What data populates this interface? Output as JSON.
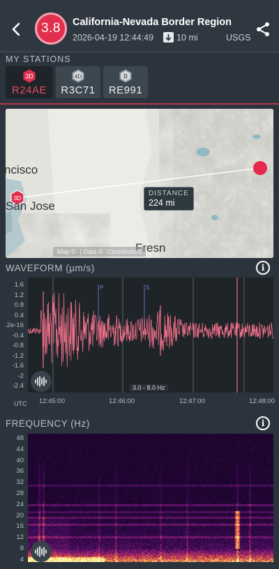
{
  "header": {
    "back_icon": "arrow-left-icon",
    "magnitude": "3.8",
    "title": "California-Nevada Border Region",
    "datetime": "2026-04-19 12:44:49",
    "distance": "10 mi",
    "distance_icon": "arrow-down-icon",
    "source": "USGS",
    "share_icon": "share-icon",
    "accent_color": "#e0304e"
  },
  "stations": {
    "section_label": "MY STATIONS",
    "items": [
      {
        "badge": "3D",
        "name": "R24AE",
        "active": true
      },
      {
        "badge": "4D",
        "name": "R3C71",
        "active": false
      },
      {
        "badge": "B",
        "name": "RE991",
        "active": false
      }
    ]
  },
  "map": {
    "labels": [
      "ncisco",
      "San Jose",
      "Fresn"
    ],
    "distance_label": "DISTANCE",
    "distance_value": "224 mi",
    "station_badge": "3D",
    "attribution_left": "Map ©",
    "attribution_mid": "| Data ©",
    "attribution_right": "Contributors"
  },
  "waveform": {
    "title": "WAVEFORM (µm/s)",
    "info_icon": "info-icon",
    "y_ticks": [
      "1.6",
      "1.2",
      "0.8",
      "0.4",
      ".2e-16",
      "-0.4",
      "-0.8",
      "-1.2",
      "-1.6",
      "-2",
      "-2.4"
    ],
    "x_ticks": [
      "12:45:00",
      "12:46:00",
      "12:47:00",
      "12:48:00"
    ],
    "x_axis_label": "UTC",
    "phase_markers": [
      "P",
      "S"
    ],
    "band": "3.0 - 8.0 Hz",
    "sound_icon": "soundwave-icon",
    "trace_color": "#f0708a"
  },
  "frequency": {
    "title": "FREQUENCY (Hz)",
    "info_icon": "info-icon",
    "y_ticks": [
      "48",
      "44",
      "40",
      "36",
      "32",
      "28",
      "24",
      "20",
      "16",
      "12",
      "8",
      "4"
    ],
    "sound_icon": "soundwave-icon"
  }
}
